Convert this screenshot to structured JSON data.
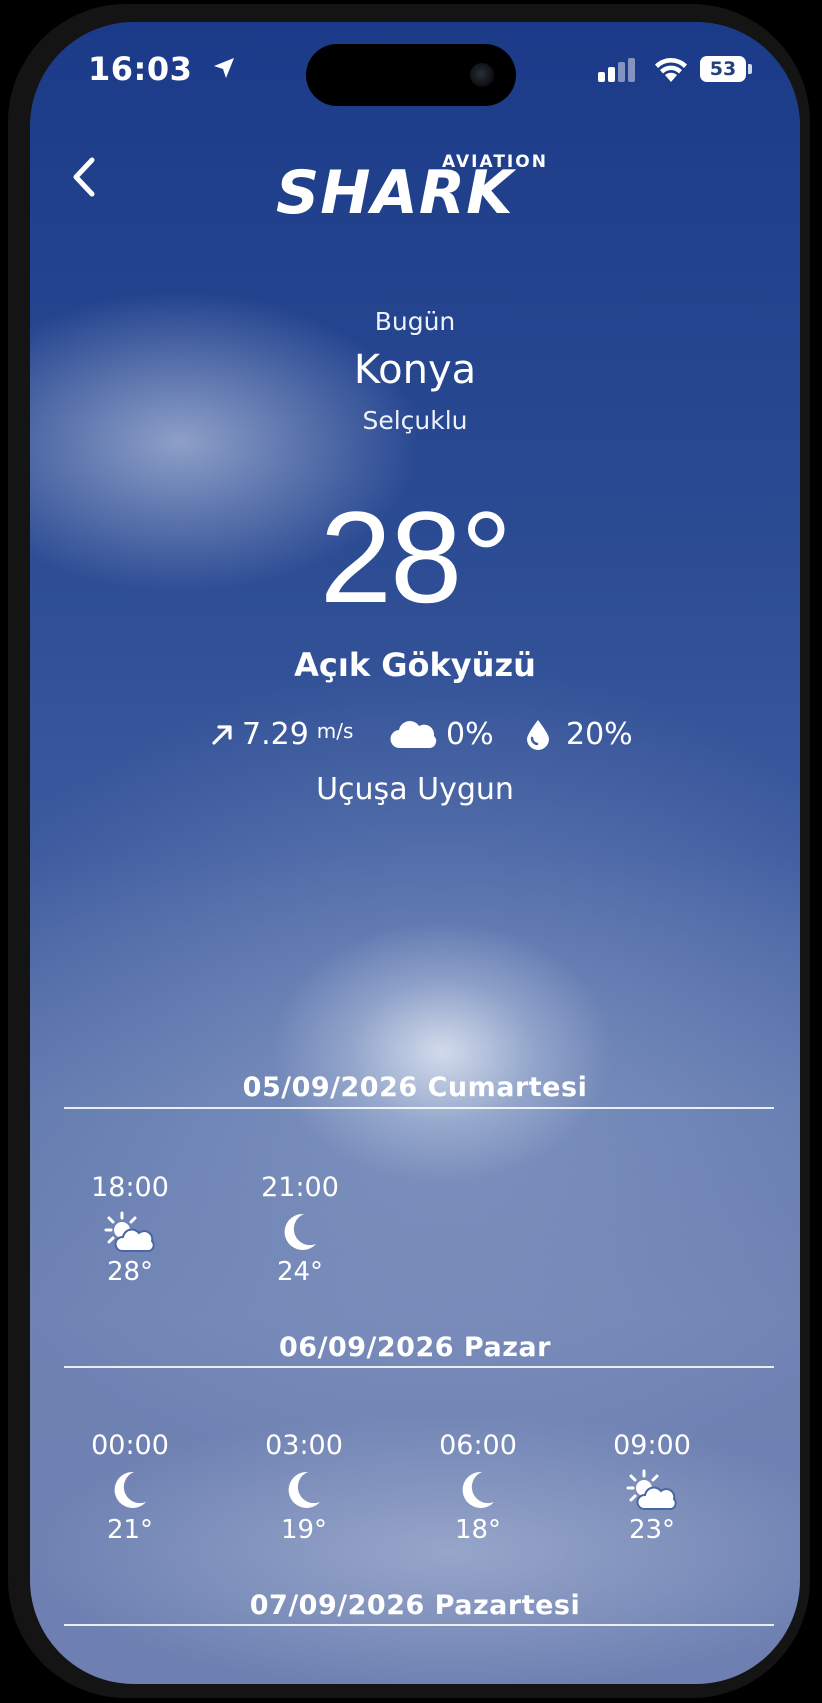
{
  "status_bar": {
    "time": "16:03",
    "battery": "53"
  },
  "header": {
    "logo_main": "SHARK",
    "logo_sub": "AVIATION"
  },
  "current": {
    "label": "Bugün",
    "city": "Konya",
    "district": "Selçuklu",
    "temperature": "28°",
    "condition": "Açık Gökyüzü",
    "wind": {
      "value": "7.29",
      "unit": "m/s"
    },
    "cloud": "0%",
    "humidity": "20%",
    "flight_status": "Uçuşa Uygun"
  },
  "forecast": [
    {
      "date": "05/09/2026 Cumartesi",
      "slots": [
        {
          "time": "18:00",
          "icon": "partly-cloudy-day-icon",
          "temp": "28°"
        },
        {
          "time": "21:00",
          "icon": "moon-icon",
          "temp": "24°"
        }
      ]
    },
    {
      "date": "06/09/2026 Pazar",
      "slots": [
        {
          "time": "00:00",
          "icon": "moon-icon",
          "temp": "21°"
        },
        {
          "time": "03:00",
          "icon": "moon-icon",
          "temp": "19°"
        },
        {
          "time": "06:00",
          "icon": "moon-icon",
          "temp": "18°"
        },
        {
          "time": "09:00",
          "icon": "partly-cloudy-day-icon",
          "temp": "23°"
        }
      ]
    },
    {
      "date": "07/09/2026 Pazartesi",
      "slots": []
    }
  ],
  "colors": {
    "sky_top": "#1b3b8a",
    "sky_bottom": "#6d80b1",
    "text": "#ffffff"
  }
}
